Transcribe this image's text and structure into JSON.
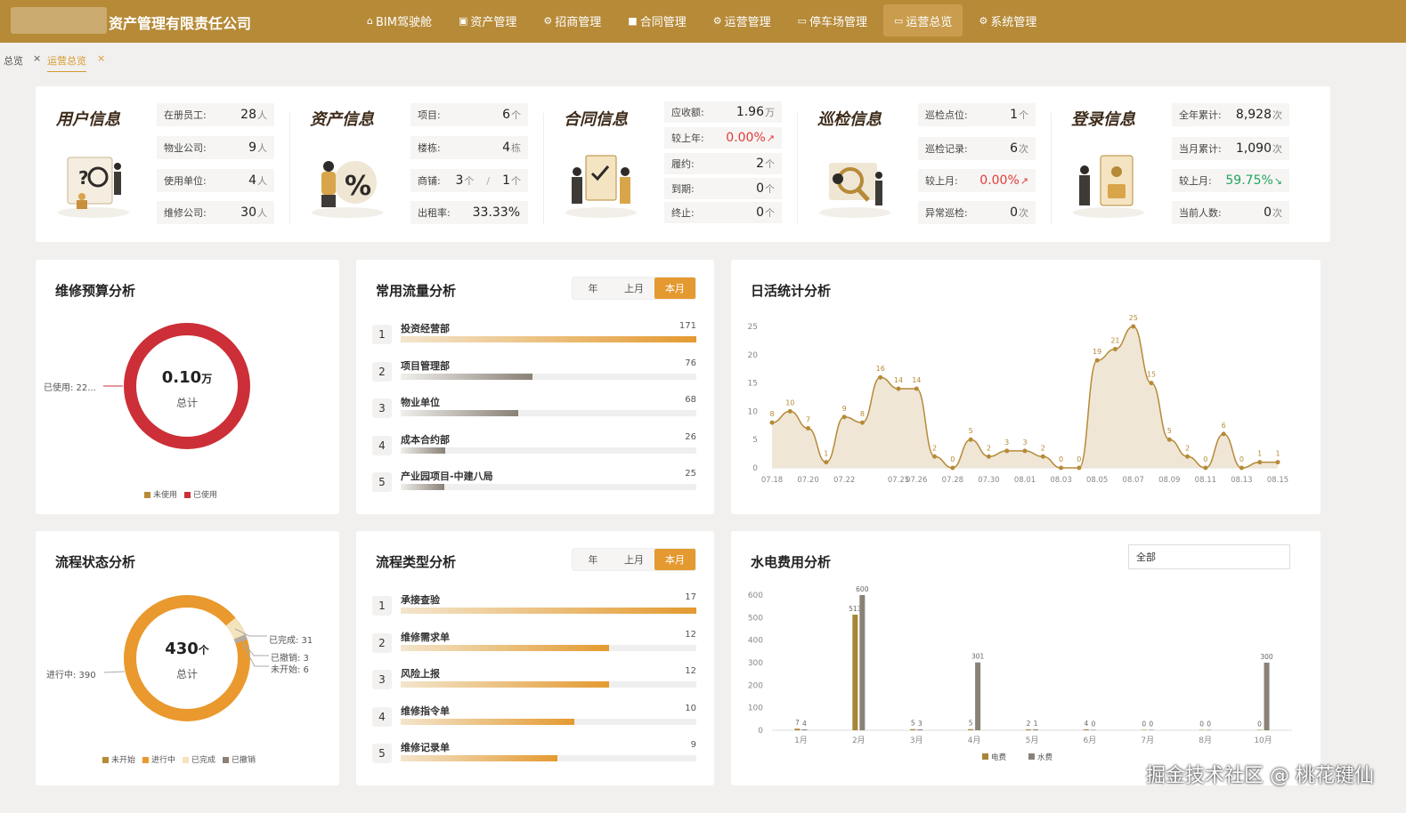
{
  "header": {
    "company": "资产管理有限责任公司",
    "nav": [
      {
        "label": "BIM驾驶舱",
        "icon": "home-icon",
        "active": false
      },
      {
        "label": "资产管理",
        "icon": "asset-icon",
        "active": false
      },
      {
        "label": "招商管理",
        "icon": "gear-icon",
        "active": false
      },
      {
        "label": "合同管理",
        "icon": "contract-icon",
        "active": false
      },
      {
        "label": "运营管理",
        "icon": "gear-icon",
        "active": false
      },
      {
        "label": "停车场管理",
        "icon": "car-icon",
        "active": false
      },
      {
        "label": "运营总览",
        "icon": "monitor-icon",
        "active": true
      },
      {
        "label": "系统管理",
        "icon": "gear-icon",
        "active": false
      }
    ]
  },
  "tabs": [
    {
      "label": "总览"
    },
    {
      "label": "运营总览",
      "active": true
    }
  ],
  "info": {
    "user": {
      "title": "用户信息",
      "rows": [
        {
          "label": "在册员工:",
          "value": "28",
          "unit": "人"
        },
        {
          "label": "物业公司:",
          "value": "9",
          "unit": "人"
        },
        {
          "label": "使用单位:",
          "value": "4",
          "unit": "人"
        },
        {
          "label": "维修公司:",
          "value": "30",
          "unit": "人"
        }
      ]
    },
    "asset": {
      "title": "资产信息",
      "rows": [
        {
          "label": "项目:",
          "value": "6",
          "unit": "个"
        },
        {
          "label": "楼栋:",
          "value": "4",
          "unit": "栋"
        },
        {
          "label": "商铺:",
          "value": "3",
          "unit": "个",
          "sep": "/",
          "value2": "1",
          "unit2": "个"
        },
        {
          "label": "出租率:",
          "value": "33.33%",
          "unit": ""
        }
      ]
    },
    "contract": {
      "title": "合同信息",
      "rows": [
        {
          "label": "应收额:",
          "value": "1.96",
          "unit": "万"
        },
        {
          "label": "较上年:",
          "value": "0.00%",
          "unit": "↗",
          "tone": "red"
        },
        {
          "label": "履约:",
          "value": "2",
          "unit": "个"
        },
        {
          "label": "到期:",
          "value": "0",
          "unit": "个"
        },
        {
          "label": "终止:",
          "value": "0",
          "unit": "个"
        }
      ]
    },
    "patrol": {
      "title": "巡检信息",
      "rows": [
        {
          "label": "巡检点位:",
          "value": "1",
          "unit": "个"
        },
        {
          "label": "巡检记录:",
          "value": "6",
          "unit": "次"
        },
        {
          "label": "较上月:",
          "value": "0.00%",
          "unit": "↗",
          "tone": "red"
        },
        {
          "label": "异常巡检:",
          "value": "0",
          "unit": "次"
        }
      ]
    },
    "login": {
      "title": "登录信息",
      "rows": [
        {
          "label": "全年累计:",
          "value": "8,928",
          "unit": "次"
        },
        {
          "label": "当月累计:",
          "value": "1,090",
          "unit": "次"
        },
        {
          "label": "较上月:",
          "value": "59.75%",
          "unit": "↘",
          "tone": "green"
        },
        {
          "label": "当前人数:",
          "value": "0",
          "unit": "次"
        }
      ]
    }
  },
  "budget": {
    "title": "维修预算分析",
    "value": "0.10",
    "unit": "万",
    "sub": "总计",
    "callout": "已使用: 22...",
    "legend": [
      "未使用",
      "已使用"
    ]
  },
  "flow": {
    "title": "常用流量分析",
    "filters": [
      "年",
      "上月",
      "本月"
    ],
    "active": "本月",
    "items": [
      {
        "rank": "1",
        "name": "投资经营部",
        "value": 171
      },
      {
        "rank": "2",
        "name": "项目管理部",
        "value": 76
      },
      {
        "rank": "3",
        "name": "物业单位",
        "value": 68
      },
      {
        "rank": "4",
        "name": "成本合约部",
        "value": 26
      },
      {
        "rank": "5",
        "name": "产业园项目-中建八局",
        "value": 25
      }
    ]
  },
  "process_status": {
    "title": "流程状态分析",
    "value": "430",
    "unit": "个",
    "sub": "总计",
    "labels": [
      "进行中: 390",
      "已完成: 31",
      "已撤销: 3",
      "未开始: 6"
    ],
    "legend": [
      "未开始",
      "进行中",
      "已完成",
      "已撤销"
    ]
  },
  "process_type": {
    "title": "流程类型分析",
    "filters": [
      "年",
      "上月",
      "本月"
    ],
    "active": "本月",
    "items": [
      {
        "rank": "1",
        "name": "承接查验",
        "value": 17
      },
      {
        "rank": "2",
        "name": "维修需求单",
        "value": 12
      },
      {
        "rank": "3",
        "name": "风险上报",
        "value": 12
      },
      {
        "rank": "4",
        "name": "维修指令单",
        "value": 10
      },
      {
        "rank": "5",
        "name": "维修记录单",
        "value": 9
      }
    ]
  },
  "water": {
    "title": "水电费用分析",
    "select": "全部"
  },
  "watermark": "掘金技术社区 @ 桃花键仙",
  "colors": {
    "brand": "#b68a37",
    "accent": "#e49a30",
    "red": "#cc2f37",
    "water": "#8a8177",
    "power": "#a8843b"
  },
  "chart_data": [
    {
      "type": "area",
      "title": "日活统计分析",
      "x": [
        "07.18",
        "07.19",
        "07.20",
        "07.21",
        "07.22",
        "07.23",
        "07.24",
        "07.25",
        "07.26",
        "07.27",
        "07.28",
        "07.29",
        "07.30",
        "07.31",
        "08.01",
        "08.02",
        "08.03",
        "08.04",
        "08.05",
        "08.06",
        "08.07",
        "08.08",
        "08.09",
        "08.10",
        "08.11",
        "08.12",
        "08.13",
        "08.14",
        "08.15"
      ],
      "xticks": [
        "07.18",
        "07.20",
        "07.22",
        "07.25",
        "07.26",
        "07.28",
        "07.30",
        "08.01",
        "08.03",
        "08.05",
        "08.07",
        "08.09",
        "08.11",
        "08.13",
        "08.15"
      ],
      "values": [
        8,
        10,
        7,
        1,
        9,
        8,
        16,
        14,
        14,
        2,
        0,
        5,
        2,
        3,
        3,
        2,
        0,
        0,
        19,
        21,
        25,
        15,
        5,
        2,
        0,
        6,
        0,
        1,
        1
      ],
      "ylim": [
        0,
        25
      ],
      "yticks": [
        0,
        5,
        10,
        15,
        20,
        25
      ]
    },
    {
      "type": "bar",
      "title": "水电费用分析",
      "categories": [
        "1月",
        "2月",
        "3月",
        "4月",
        "5月",
        "6月",
        "7月",
        "8月",
        "10月"
      ],
      "series": [
        {
          "name": "电费",
          "values": [
            7,
            513,
            5,
            5,
            2,
            4,
            0,
            0,
            0
          ]
        },
        {
          "name": "水费",
          "values": [
            4,
            600,
            3,
            301,
            1,
            0,
            0,
            0,
            300
          ]
        }
      ],
      "ylim": [
        0,
        600
      ],
      "yticks": [
        0,
        100,
        200,
        300,
        400,
        500,
        600
      ]
    }
  ]
}
